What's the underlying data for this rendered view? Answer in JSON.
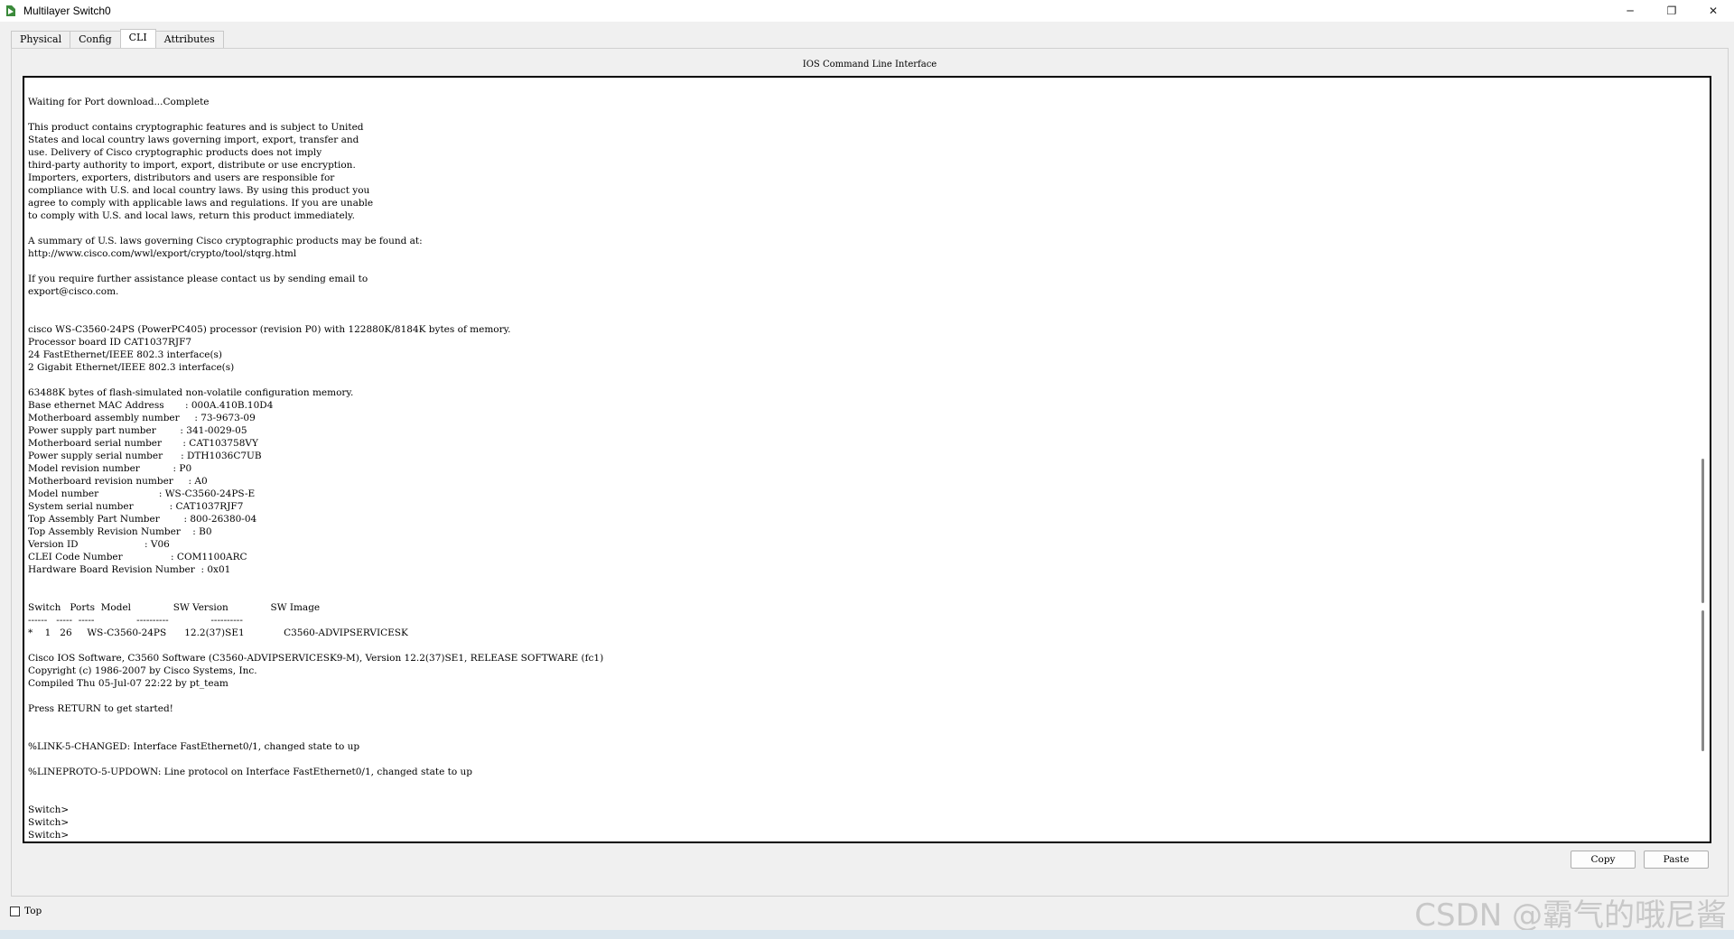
{
  "window": {
    "title": "Multilayer Switch0",
    "minimize_glyph": "─",
    "restore_glyph": "❐",
    "close_glyph": "✕"
  },
  "tabs": [
    {
      "label": "Physical"
    },
    {
      "label": "Config"
    },
    {
      "label": "CLI",
      "active": true
    },
    {
      "label": "Attributes"
    }
  ],
  "cli": {
    "header": "IOS Command Line Interface",
    "output": "                    ·                              ·\n\nWaiting for Port download...Complete\n\nThis product contains cryptographic features and is subject to United\nStates and local country laws governing import, export, transfer and\nuse. Delivery of Cisco cryptographic products does not imply\nthird-party authority to import, export, distribute or use encryption.\nImporters, exporters, distributors and users are responsible for\ncompliance with U.S. and local country laws. By using this product you\nagree to comply with applicable laws and regulations. If you are unable\nto comply with U.S. and local laws, return this product immediately.\n\nA summary of U.S. laws governing Cisco cryptographic products may be found at:\nhttp://www.cisco.com/wwl/export/crypto/tool/stqrg.html\n\nIf you require further assistance please contact us by sending email to\nexport@cisco.com.\n\n\ncisco WS-C3560-24PS (PowerPC405) processor (revision P0) with 122880K/8184K bytes of memory.\nProcessor board ID CAT1037RJF7\n24 FastEthernet/IEEE 802.3 interface(s)\n2 Gigabit Ethernet/IEEE 802.3 interface(s)\n\n63488K bytes of flash-simulated non-volatile configuration memory.\nBase ethernet MAC Address       : 000A.410B.10D4\nMotherboard assembly number     : 73-9673-09\nPower supply part number        : 341-0029-05\nMotherboard serial number       : CAT103758VY\nPower supply serial number      : DTH1036C7UB\nModel revision number           : P0\nMotherboard revision number     : A0\nModel number                    : WS-C3560-24PS-E\nSystem serial number            : CAT1037RJF7\nTop Assembly Part Number        : 800-26380-04\nTop Assembly Revision Number    : B0\nVersion ID                      : V06\nCLEI Code Number                : COM1100ARC\nHardware Board Revision Number  : 0x01\n\n\nSwitch   Ports  Model              SW Version              SW Image\n------   -----  -----              ----------              ----------\n*    1   26     WS-C3560-24PS      12.2(37)SE1             C3560-ADVIPSERVICESK\n\nCisco IOS Software, C3560 Software (C3560-ADVIPSERVICESK9-M), Version 12.2(37)SE1, RELEASE SOFTWARE (fc1)\nCopyright (c) 1986-2007 by Cisco Systems, Inc.\nCompiled Thu 05-Jul-07 22:22 by pt_team\n\nPress RETURN to get started!\n\n\n%LINK-5-CHANGED: Interface FastEthernet0/1, changed state to up\n\n%LINEPROTO-5-UPDOWN: Line protocol on Interface FastEthernet0/1, changed state to up\n\n\nSwitch>\nSwitch>\nSwitch>"
  },
  "buttons": {
    "copy_label": "Copy",
    "paste_label": "Paste"
  },
  "options": {
    "top_label": "Top",
    "top_checked": false
  },
  "watermark": "CSDN @霸气的哦尼酱"
}
